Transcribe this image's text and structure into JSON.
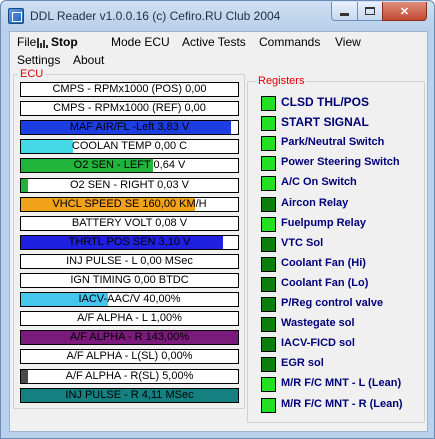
{
  "window": {
    "title": "DDL Reader v1.0.0.16 (c)  Cefiro.RU Club 2004",
    "close_glyph": "✕"
  },
  "menu": {
    "file": "File",
    "stop": "Stop",
    "mode_ecu": "Mode ECU",
    "active_tests": "Active Tests",
    "commands": "Commands",
    "view": "View",
    "settings": "Settings",
    "about": "About"
  },
  "ecu": {
    "label": "ECU",
    "gauges": [
      {
        "text": "CMPS - RPMx1000 (POS) 0,00",
        "level": 0.0,
        "color": "#ffffff"
      },
      {
        "text": "CMPS - RPMx1000 (REF) 0,00",
        "level": 0.0,
        "color": "#ffffff"
      },
      {
        "text": "MAF AIR/FL -Left 3,83 V",
        "level": 0.97,
        "color": "#1c3ee0"
      },
      {
        "text": "COOLAN TEMP 0,00 C",
        "level": 0.24,
        "color": "#45d9e8"
      },
      {
        "text": "O2 SEN - LEFT 0,64 V",
        "level": 0.61,
        "color": "#22b43a"
      },
      {
        "text": "O2 SEN - RIGHT 0,03 V",
        "level": 0.03,
        "color": "#22b43a"
      },
      {
        "text": "VHCL SPEED SE 160,00 KM/H",
        "level": 0.8,
        "color": "#f0a21a"
      },
      {
        "text": "BATTERY VOLT 0,08 V",
        "level": 0.0,
        "color": "#ffffff"
      },
      {
        "text": "THRTL POS SEN 3,10 V",
        "level": 0.93,
        "color": "#1f1fe0"
      },
      {
        "text": "INJ PULSE - L 0,00 MSec",
        "level": 0.0,
        "color": "#ffffff"
      },
      {
        "text": "IGN TIMING 0,00 BTDC",
        "level": 0.0,
        "color": "#ffffff"
      },
      {
        "text": "IACV-AAC/V 40,00%",
        "level": 0.4,
        "color": "#45c6ec"
      },
      {
        "text": "A/F ALPHA - L 1,00%",
        "level": 0.0,
        "color": "#ffffff"
      },
      {
        "text": "A/F ALPHA - R 143,00%",
        "level": 1.0,
        "color": "#7a1a7a"
      },
      {
        "text": "A/F ALPHA - L(SL) 0,00%",
        "level": 0.0,
        "color": "#ffffff"
      },
      {
        "text": "A/F ALPHA - R(SL) 5,00%",
        "level": 0.03,
        "color": "#4a4a4a"
      },
      {
        "text": "INJ PULSE - R 4,11 MSec",
        "level": 1.0,
        "color": "#148080"
      }
    ]
  },
  "registers": {
    "label": "Registers",
    "items": [
      {
        "text": "CLSD THL/POS",
        "on": true
      },
      {
        "text": "START SIGNAL",
        "on": true
      },
      {
        "text": "Park/Neutral Switch",
        "on": true
      },
      {
        "text": "Power Steering Switch",
        "on": true
      },
      {
        "text": "A/C On Switch",
        "on": true
      },
      {
        "text": "Aircon Relay",
        "on": false
      },
      {
        "text": "Fuelpump Relay",
        "on": true
      },
      {
        "text": "VTC Sol",
        "on": false
      },
      {
        "text": "Coolant Fan (Hi)",
        "on": false
      },
      {
        "text": "Coolant Fan (Lo)",
        "on": false
      },
      {
        "text": "P/Reg control valve",
        "on": false
      },
      {
        "text": "Wastegate sol",
        "on": false
      },
      {
        "text": "IACV-FICD sol",
        "on": false
      },
      {
        "text": "EGR sol",
        "on": false
      },
      {
        "text": "M/R F/C MNT - L (Lean)",
        "on": true
      },
      {
        "text": "M/R F/C MNT - R (Lean)",
        "on": true
      }
    ],
    "on_color": "#22e022",
    "off_color": "#0d7d0d"
  }
}
